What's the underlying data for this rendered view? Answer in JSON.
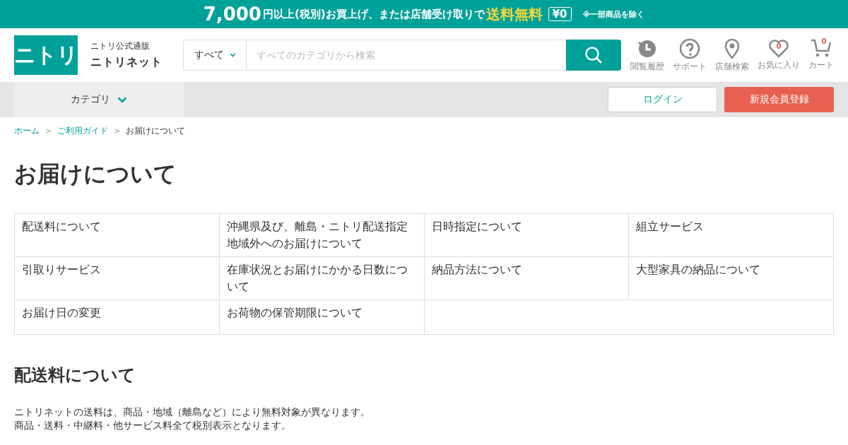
{
  "banner": {
    "amount": "7,000",
    "text": "円以上(税別)お買上げ、または店舗受け取りで",
    "highlight": "送料無料",
    "tag": "¥0",
    "note": "※一部商品を除く"
  },
  "header": {
    "logo": "ニトリ",
    "subtitle": "ニトリ公式通販",
    "site_name": "ニトリネット",
    "search": {
      "scope": "すべて",
      "placeholder": "すべてのカテゴリから検索"
    },
    "icons": [
      {
        "kind": "history",
        "label": "閲覧履歴"
      },
      {
        "kind": "help",
        "label": "サポート"
      },
      {
        "kind": "pin",
        "label": "店舗検索"
      },
      {
        "kind": "heart",
        "label": "お気に入り",
        "count": "0"
      },
      {
        "kind": "cart",
        "label": "カート",
        "count": "0"
      }
    ]
  },
  "nav": {
    "category": "カテゴリ",
    "login": "ログイン",
    "register": "新規会員登録"
  },
  "breadcrumb": [
    {
      "kind": "link",
      "label": "ホーム"
    },
    {
      "kind": "link",
      "label": "ご利用ガイド",
      "separator": ">"
    },
    {
      "kind": "current",
      "label": "お届けについて",
      "separator": ">"
    }
  ],
  "title": "お届けについて",
  "links": [
    "配送料について",
    "沖縄県及び、離島・ニトリ配送指定地域外へのお届けについて",
    "日時指定について",
    "組立サービス",
    "引取りサービス",
    "在庫状況とお届けにかかる日数について",
    "納品方法について",
    "大型家具の納品について",
    "お届け日の変更",
    "お荷物の保管期限について"
  ],
  "section": {
    "heading": "配送料について",
    "paragraphs": [
      "ニトリネットの送料は、商品・地域（離島など）により無料対象が異なります。",
      "商品・送料・中継料・他サービス料全て税別表示となります。"
    ]
  }
}
